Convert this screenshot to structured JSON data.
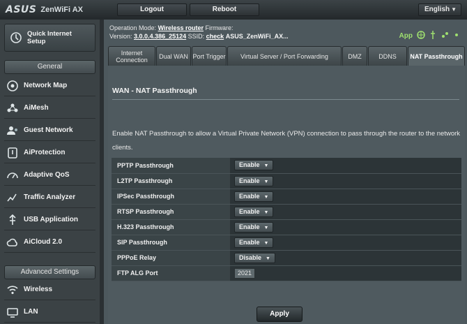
{
  "header": {
    "brand": "ASUS",
    "model": "ZenWiFi AX",
    "logout": "Logout",
    "reboot": "Reboot",
    "language": "English"
  },
  "sidebar": {
    "quick_setup": "Quick Internet Setup",
    "general_head": "General",
    "general_items": [
      {
        "label": "Network Map",
        "icon": "network-map-icon"
      },
      {
        "label": "AiMesh",
        "icon": "aimesh-icon"
      },
      {
        "label": "Guest Network",
        "icon": "guest-network-icon"
      },
      {
        "label": "AiProtection",
        "icon": "aiprotection-icon"
      },
      {
        "label": "Adaptive QoS",
        "icon": "adaptive-qos-icon"
      },
      {
        "label": "Traffic Analyzer",
        "icon": "traffic-analyzer-icon"
      },
      {
        "label": "USB Application",
        "icon": "usb-application-icon"
      },
      {
        "label": "AiCloud 2.0",
        "icon": "aicloud-icon"
      }
    ],
    "advanced_head": "Advanced Settings",
    "advanced_items": [
      {
        "label": "Wireless",
        "icon": "wireless-icon"
      },
      {
        "label": "LAN",
        "icon": "lan-icon"
      }
    ]
  },
  "status": {
    "op_mode_label": "Operation Mode:",
    "op_mode_value": "Wireless router",
    "firmware_label": "Firmware:",
    "ssid_label": "SSID:",
    "version_label": "Version:",
    "version_value": "3.0.0.4.386_25124",
    "check": "check",
    "ssid_value": "ASUS_ZenWiFi_AX...",
    "app_label": "App"
  },
  "tabs": [
    "Internet Connection",
    "Dual WAN",
    "Port Trigger",
    "Virtual Server / Port Forwarding",
    "DMZ",
    "DDNS",
    "NAT Passthrough"
  ],
  "panel": {
    "title": "WAN - NAT Passthrough",
    "description": "Enable NAT Passthrough to allow a Virtual Private Network (VPN) connection to pass through the router to the network clients.",
    "rows": [
      {
        "label": "PPTP Passthrough",
        "value": "Enable"
      },
      {
        "label": "L2TP Passthrough",
        "value": "Enable"
      },
      {
        "label": "IPSec Passthrough",
        "value": "Enable"
      },
      {
        "label": "RTSP Passthrough",
        "value": "Enable"
      },
      {
        "label": "H.323 Passthrough",
        "value": "Enable"
      },
      {
        "label": "SIP Passthrough",
        "value": "Enable"
      },
      {
        "label": "PPPoE Relay",
        "value": "Disable"
      }
    ],
    "ftp_label": "FTP ALG Port",
    "ftp_value": "2021",
    "apply": "Apply"
  }
}
